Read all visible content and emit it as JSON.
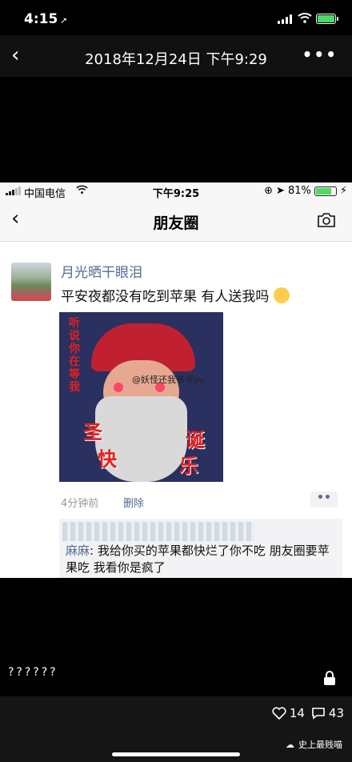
{
  "outer_status": {
    "time": "4:15",
    "location_arrow": "location-arrow-icon",
    "battery_color": "#4cd964"
  },
  "outer_nav": {
    "back": "back-chevron-icon",
    "title": "2018年12月24日 下午9:29",
    "more": "•••"
  },
  "inner_status": {
    "carrier": "中国电信",
    "time": "下午9:25",
    "battery": "81%"
  },
  "inner_nav": {
    "title": "朋友圈",
    "camera": "camera-icon"
  },
  "post": {
    "author": "月光晒干眼泪",
    "text": "平安夜都没有吃到苹果 有人送我吗",
    "image_text_left": "听说你在等我",
    "image_big_1": "圣",
    "image_big_2": "快",
    "image_big_3": "诞",
    "image_big_4": "乐",
    "image_watermark": "@妖怪还我爷爷yu",
    "time_ago": "4分钟前",
    "delete": "删除"
  },
  "comment": {
    "who": "麻麻",
    "text": ": 我给你买的苹果都快烂了你不吃 朋友圈要苹果吃 我看你是疯了"
  },
  "caption": "??????",
  "footer": {
    "likes": "14",
    "comments": "43",
    "brand": "史上最贱喵"
  },
  "colors": {
    "link": "#576b95",
    "wechat_nav": "#f7f7f7"
  }
}
